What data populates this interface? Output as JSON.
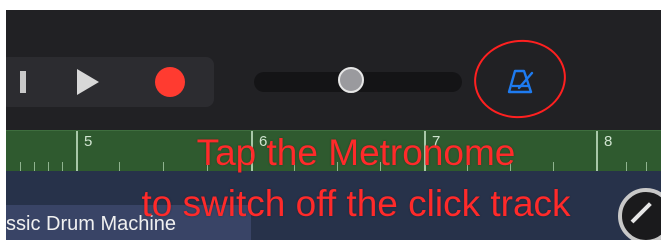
{
  "transport": {
    "rewind_icon": "rewind-icon",
    "play_icon": "play-icon",
    "record_icon": "record-icon",
    "record_color": "#ff3b30"
  },
  "volume": {
    "level": 0.46
  },
  "metronome": {
    "icon": "metronome-icon",
    "color": "#1e7bf0",
    "state": "on"
  },
  "ruler": {
    "bars": [
      "5",
      "6",
      "7",
      "8"
    ]
  },
  "track": {
    "name": "ssic Drum Machine"
  },
  "annotation": {
    "line1": "Tap the Metronome",
    "line2": "to switch off the click track",
    "color": "#ff2a2a"
  }
}
